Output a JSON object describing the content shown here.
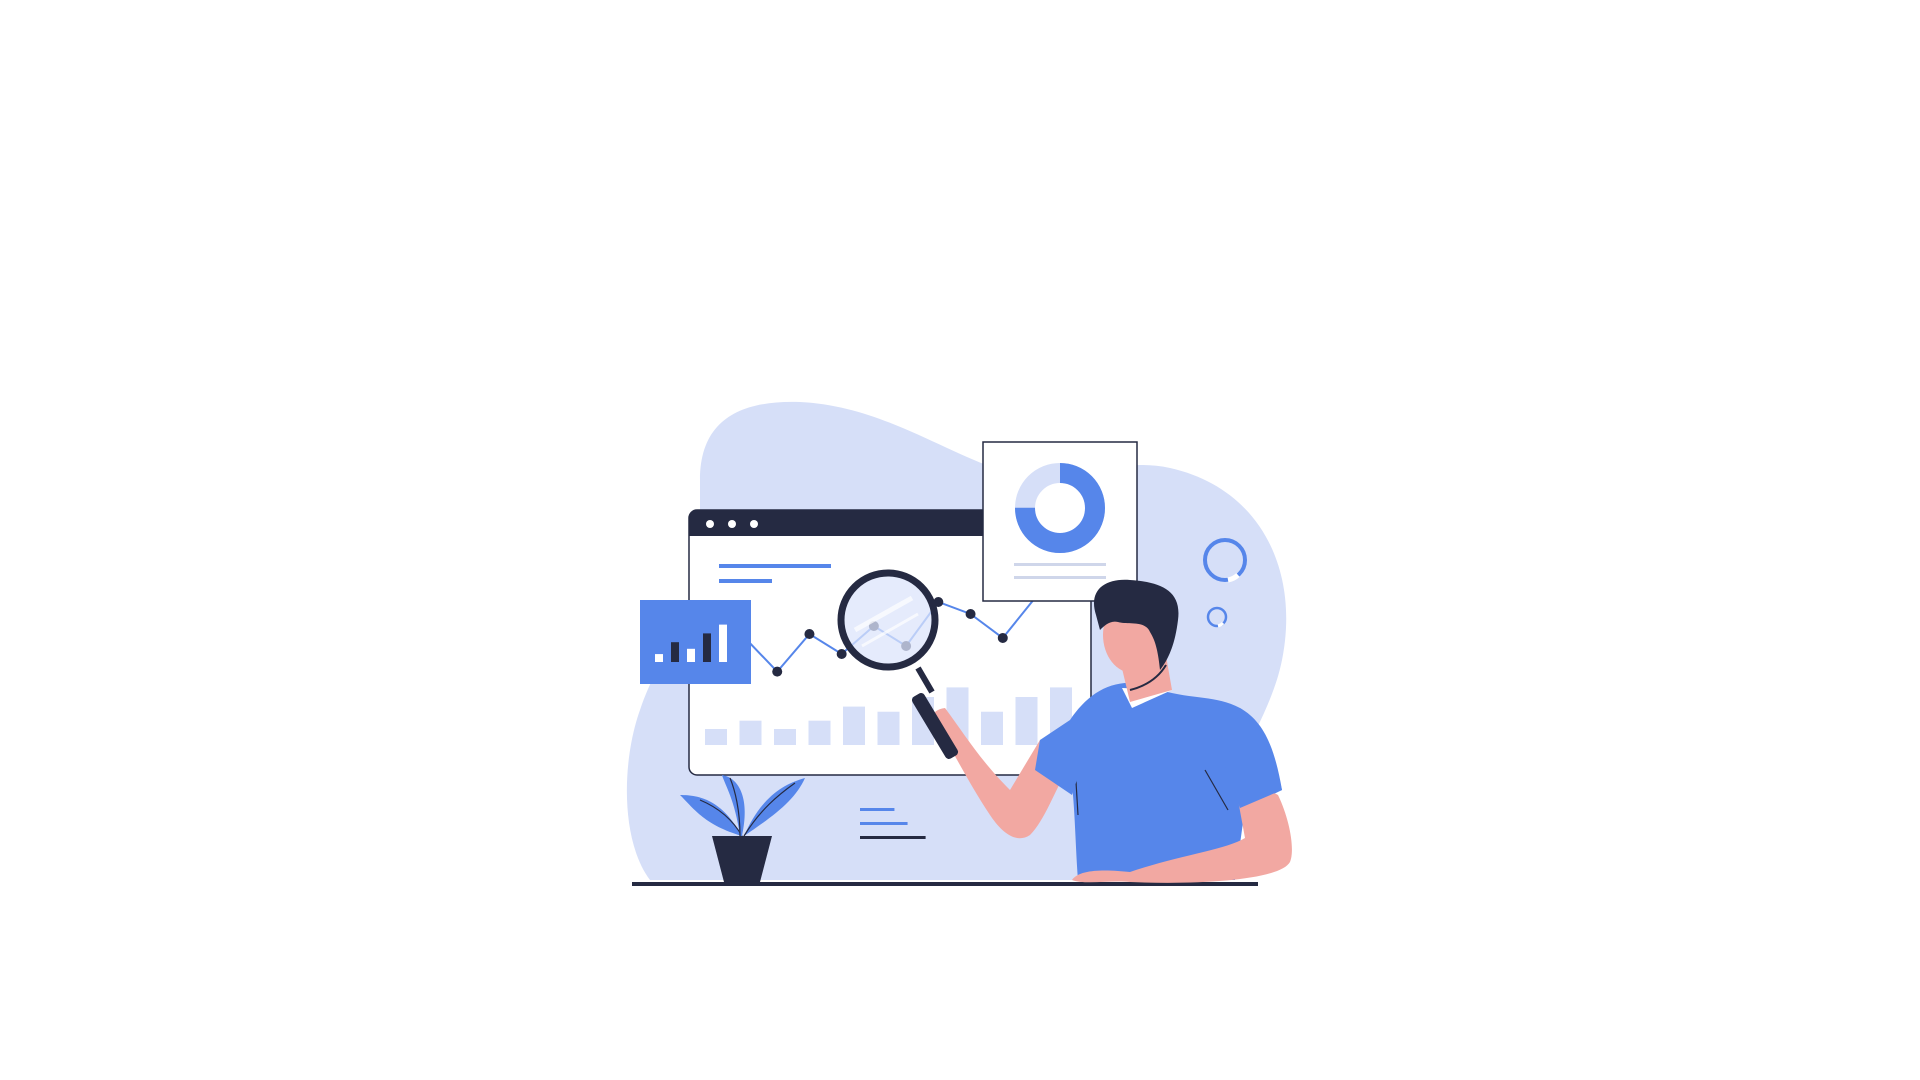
{
  "scene": {
    "background": "#ffffff",
    "palette": {
      "blob": "#d6dff8",
      "accent": "#5686ea",
      "dark": "#252a42",
      "light_bar": "#d6dff8",
      "skin": "#f2a8a2",
      "white": "#ffffff",
      "grey_line": "#cfd6ea"
    },
    "icons": [
      "browser-window-icon",
      "line-chart-icon",
      "bar-chart-card-icon",
      "donut-chart-card-icon",
      "magnifying-glass-icon",
      "ring-icon",
      "potted-plant-icon",
      "legend-lines-icon",
      "person-figure"
    ],
    "window_chart": {
      "bars": [
        0.25,
        0.38,
        0.25,
        0.38,
        0.6,
        0.52,
        0.75,
        0.9,
        0.52,
        0.75,
        0.9
      ],
      "line_points": [
        0.5,
        0.92,
        0.45,
        0.7,
        0.35,
        0.6,
        0.05,
        0.2,
        0.5,
        0.0
      ]
    },
    "small_bar_card": {
      "bars": [
        0.18,
        0.45,
        0.3,
        0.65,
        0.85
      ]
    },
    "donut": {
      "filled_fraction": 0.75
    },
    "legend_lines": [
      {
        "filled_fraction": 0.42
      },
      {
        "filled_fraction": 0.58
      },
      {
        "filled_fraction": 0.8
      }
    ]
  }
}
